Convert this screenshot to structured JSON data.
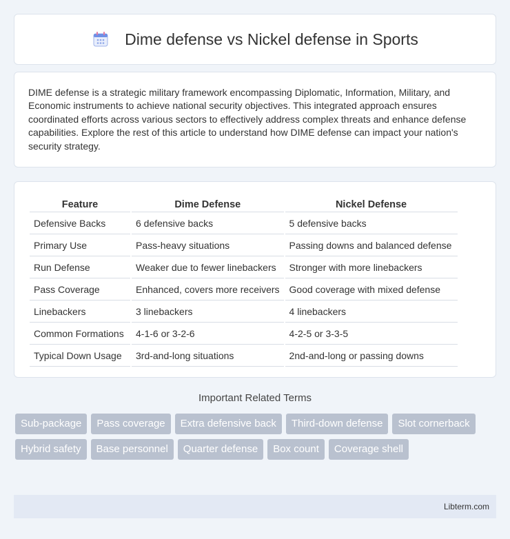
{
  "header": {
    "title": "Dime defense vs Nickel defense in Sports",
    "icon": "calendar-icon"
  },
  "intro": {
    "text": "DIME defense is a strategic military framework encompassing Diplomatic, Information, Military, and Economic instruments to achieve national security objectives. This integrated approach ensures coordinated efforts across various sectors to effectively address complex threats and enhance defense capabilities. Explore the rest of this article to understand how DIME defense can impact your nation's security strategy."
  },
  "table": {
    "headers": [
      "Feature",
      "Dime Defense",
      "Nickel Defense"
    ],
    "rows": [
      [
        "Defensive Backs",
        "6 defensive backs",
        "5 defensive backs"
      ],
      [
        "Primary Use",
        "Pass-heavy situations",
        "Passing downs and balanced defense"
      ],
      [
        "Run Defense",
        "Weaker due to fewer linebackers",
        "Stronger with more linebackers"
      ],
      [
        "Pass Coverage",
        "Enhanced, covers more receivers",
        "Good coverage with mixed defense"
      ],
      [
        "Linebackers",
        "3 linebackers",
        "4 linebackers"
      ],
      [
        "Common Formations",
        "4-1-6 or 3-2-6",
        "4-2-5 or 3-3-5"
      ],
      [
        "Typical Down Usage",
        "3rd-and-long situations",
        "2nd-and-long or passing downs"
      ]
    ]
  },
  "related": {
    "title": "Important Related Terms",
    "tags": [
      "Sub-package",
      "Pass coverage",
      "Extra defensive back",
      "Third-down defense",
      "Slot cornerback",
      "Hybrid safety",
      "Base personnel",
      "Quarter defense",
      "Box count",
      "Coverage shell"
    ]
  },
  "footer": {
    "text": "Libterm.com"
  }
}
